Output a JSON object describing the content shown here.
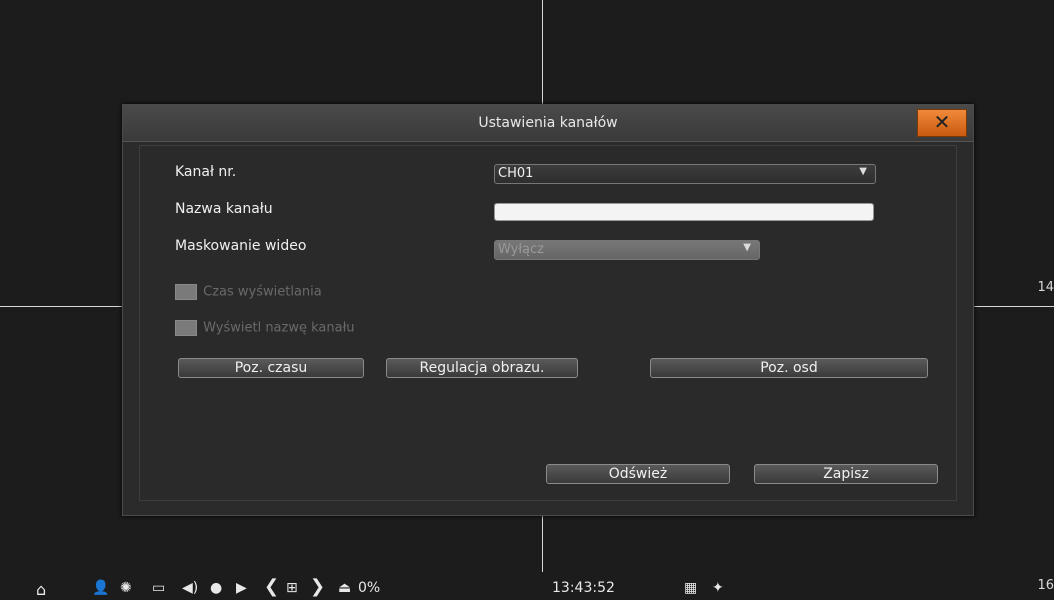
{
  "dialog": {
    "title": "Ustawienia kanałów",
    "close_glyph": "✕"
  },
  "fields": {
    "channel_label": "Kanał nr.",
    "channel_value": "CH01",
    "name_label": "Nazwa kanału",
    "name_value": "",
    "masking_label": "Maskowanie wideo",
    "masking_value": "Wyłącz"
  },
  "checkboxes": {
    "show_time": "Czas wyświetlania",
    "show_name": "Wyświetl nazwę kanału"
  },
  "buttons": {
    "time_pos": "Poz. czasu",
    "image_adjust": "Regulacja obrazu.",
    "osd_pos": "Poz. osd",
    "refresh": "Odśwież",
    "save": "Zapisz"
  },
  "background": {
    "channel_14": "14",
    "channel_16": "16"
  },
  "taskbar": {
    "hdd_usage": "0%",
    "time": "13:43:52"
  },
  "icons": {
    "menu": "home-icon",
    "user": "user-icon",
    "alarm": "alarm-icon",
    "ptz": "ptz-icon",
    "audio": "speaker-icon",
    "record": "record-icon",
    "playback": "playback-icon",
    "prev": "chevron-left-icon",
    "layout": "grid-layout-icon",
    "next": "chevron-right-icon",
    "hdd": "hdd-icon",
    "qr": "qr-code-icon",
    "pin": "pin-icon"
  }
}
